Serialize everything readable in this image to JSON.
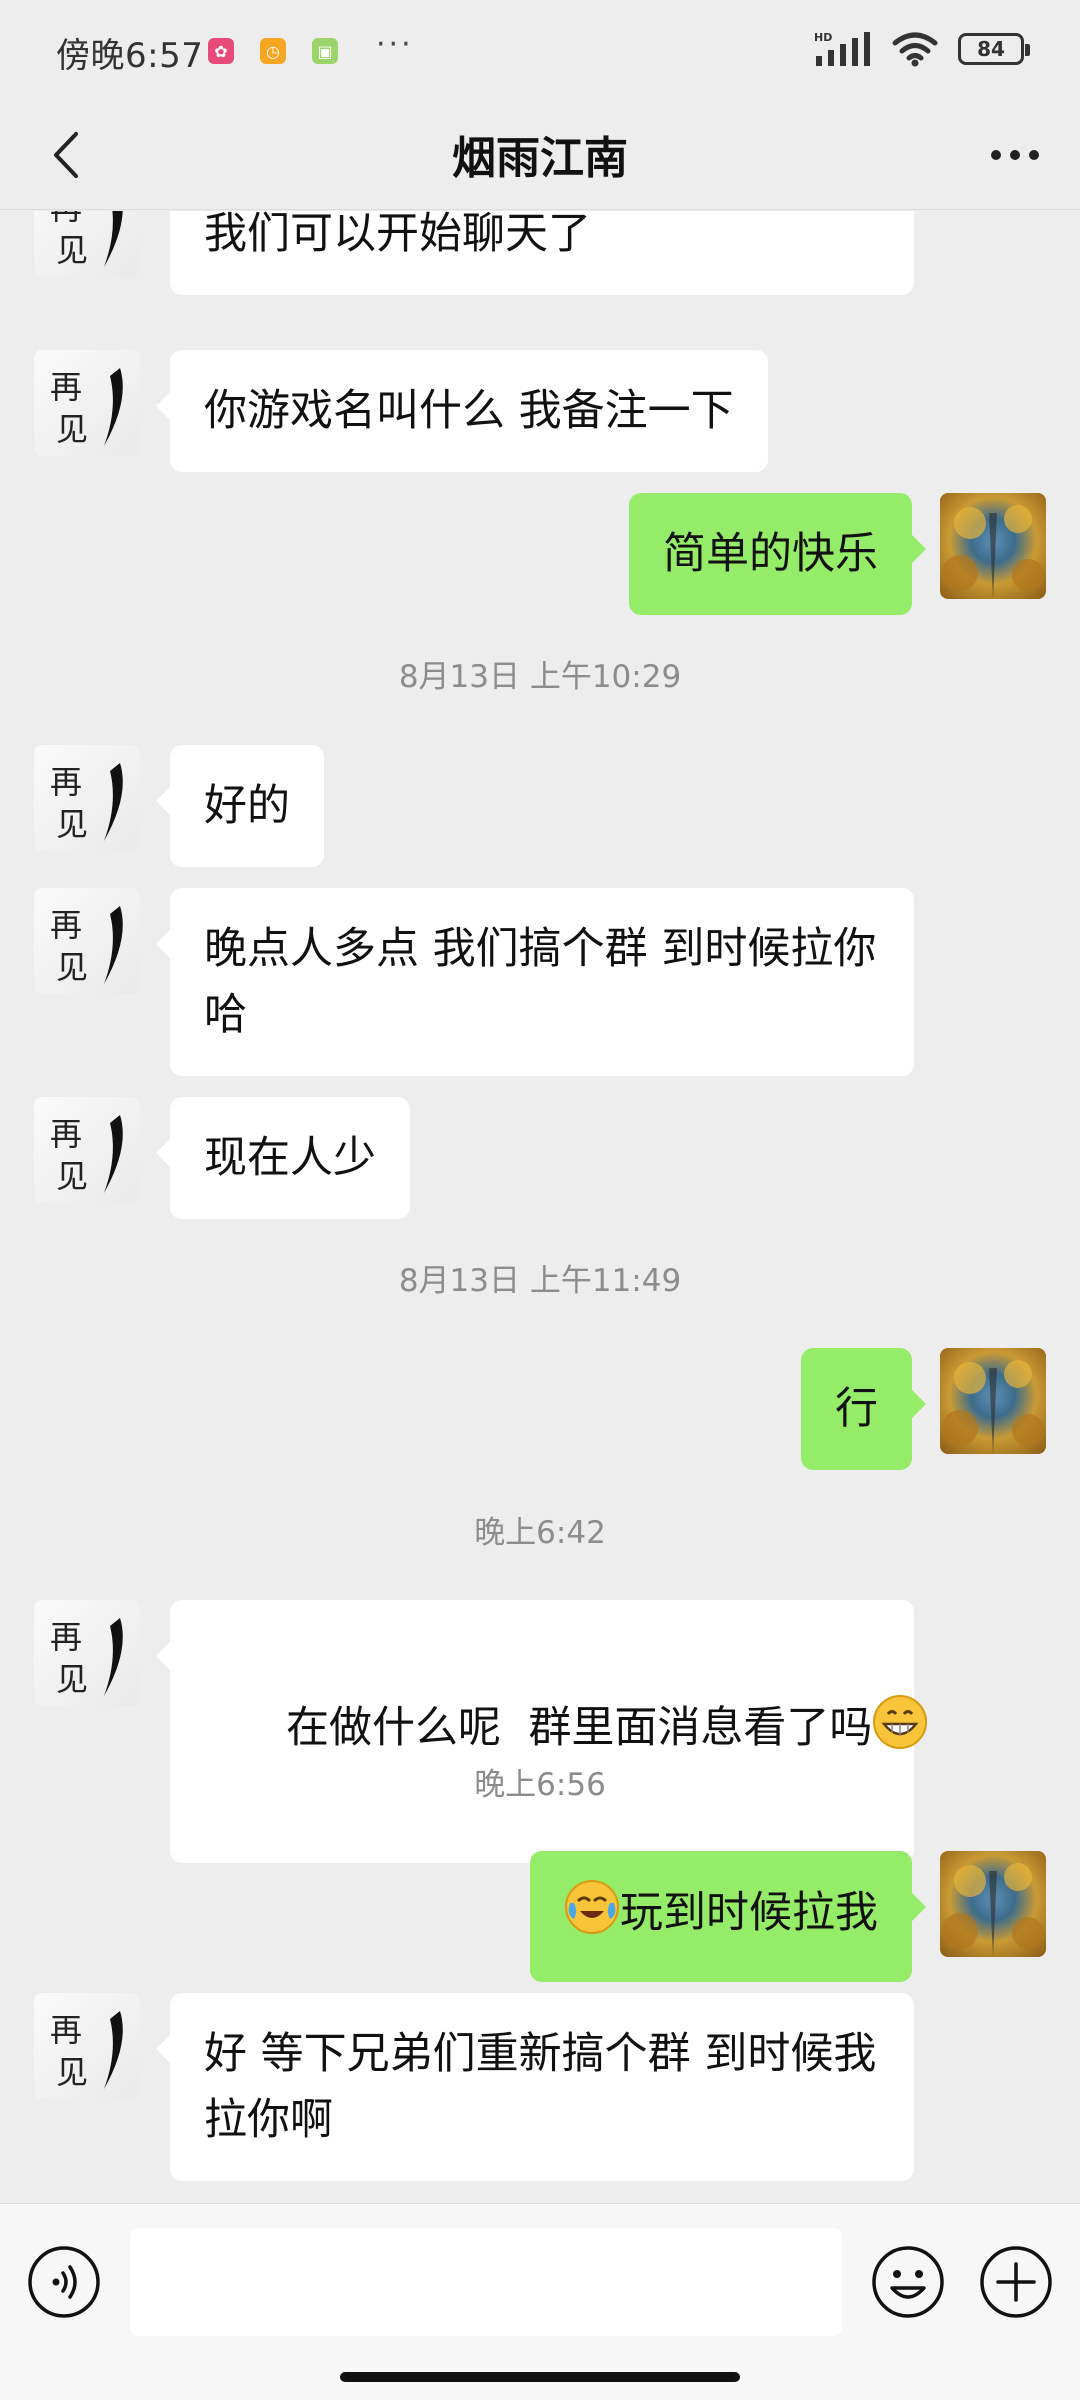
{
  "status_bar": {
    "time": "傍晚6:57",
    "network": "HD",
    "battery": "84"
  },
  "header": {
    "title": "烟雨江南"
  },
  "messages": [
    {
      "side": "left",
      "text": "我们可以开始聊天了"
    },
    {
      "side": "left",
      "text": "你游戏名叫什么 我备注一下"
    },
    {
      "side": "right",
      "text": "简单的快乐"
    },
    {
      "timestamp": "8月13日 上午10:29"
    },
    {
      "side": "left",
      "text": "好的"
    },
    {
      "side": "left",
      "text": "晚点人多点 我们搞个群 到时候拉你哈"
    },
    {
      "side": "left",
      "text": "现在人少"
    },
    {
      "timestamp": "8月13日 上午11:49"
    },
    {
      "side": "right",
      "text": "行"
    },
    {
      "timestamp": "晚上6:42"
    },
    {
      "side": "left",
      "text": "在做什么呢  群里面消息看了吗"
    },
    {
      "timestamp": "晚上6:56"
    },
    {
      "side": "right",
      "text": "玩到时候拉我"
    },
    {
      "side": "left",
      "text": "好 等下兄弟们重新搞个群 到时候我拉你啊"
    }
  ],
  "avatars": {
    "contact": "zaijian-calligraphy-avatar",
    "self": "autumn-tree-avatar"
  },
  "input_bar": {
    "value": "",
    "voice_icon": "voice-icon",
    "emoji_icon": "emoji-icon",
    "plus_icon": "plus-icon"
  },
  "colors": {
    "background": "#ededed",
    "self_bubble": "#95ec69",
    "other_bubble": "#ffffff",
    "timestamp": "#8c8c8c"
  }
}
